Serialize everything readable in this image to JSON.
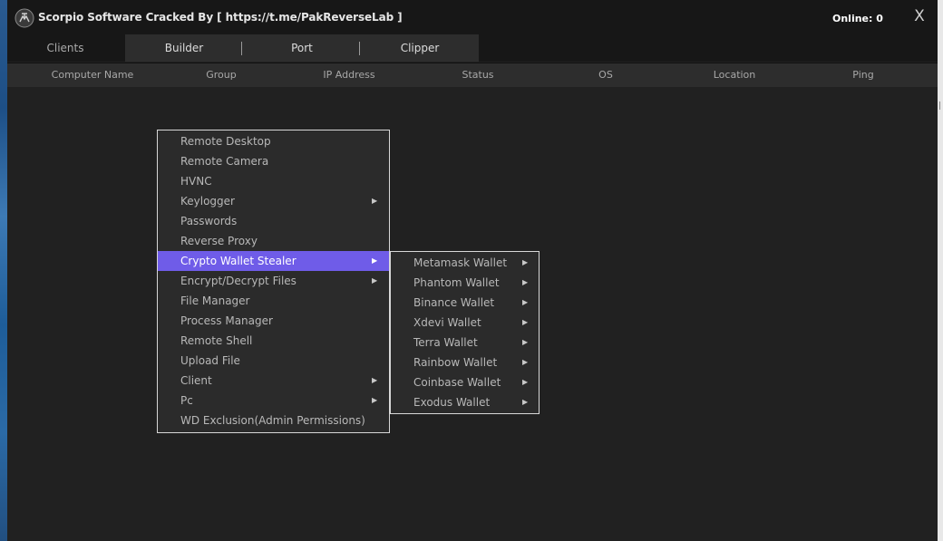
{
  "window": {
    "title": "Scorpio Software Cracked By [ https://t.me/PakReverseLab ]",
    "online": "Online: 0",
    "close_label": "X",
    "logo_icon": "scorpion-logo-icon"
  },
  "tabs": [
    {
      "label": "Clients"
    },
    {
      "label": "Builder"
    },
    {
      "label": "Port"
    },
    {
      "label": "Clipper"
    }
  ],
  "columns": [
    "Computer Name",
    "Group",
    "IP Address",
    "Status",
    "OS",
    "Location",
    "Ping"
  ],
  "context_menu": {
    "items": [
      {
        "label": "Remote Desktop",
        "submenu": false
      },
      {
        "label": "Remote Camera",
        "submenu": false
      },
      {
        "label": "HVNC",
        "submenu": false
      },
      {
        "label": "Keylogger",
        "submenu": true
      },
      {
        "label": "Passwords",
        "submenu": false
      },
      {
        "label": "Reverse Proxy",
        "submenu": false
      },
      {
        "label": "Crypto Wallet Stealer",
        "submenu": true,
        "highlighted": true
      },
      {
        "label": "Encrypt/Decrypt Files",
        "submenu": true
      },
      {
        "label": "File Manager",
        "submenu": false
      },
      {
        "label": "Process Manager",
        "submenu": false
      },
      {
        "label": "Remote Shell",
        "submenu": false
      },
      {
        "label": "Upload File",
        "submenu": false
      },
      {
        "label": "Client",
        "submenu": true
      },
      {
        "label": "Pc",
        "submenu": true
      },
      {
        "label": "WD Exclusion(Admin Permissions)",
        "submenu": false
      }
    ]
  },
  "wallet_submenu": {
    "items": [
      {
        "label": "Metamask Wallet"
      },
      {
        "label": "Phantom Wallet"
      },
      {
        "label": "Binance Wallet"
      },
      {
        "label": "Xdevi Wallet"
      },
      {
        "label": "Terra Wallet"
      },
      {
        "label": "Rainbow Wallet"
      },
      {
        "label": "Coinbase Wallet"
      },
      {
        "label": "Exodus Wallet"
      }
    ]
  },
  "arrow_glyph": "▶",
  "colors": {
    "highlight": "#6f5ce8",
    "background": "#212121",
    "titlebar": "#171717",
    "menu_border": "#d8d8d8"
  }
}
